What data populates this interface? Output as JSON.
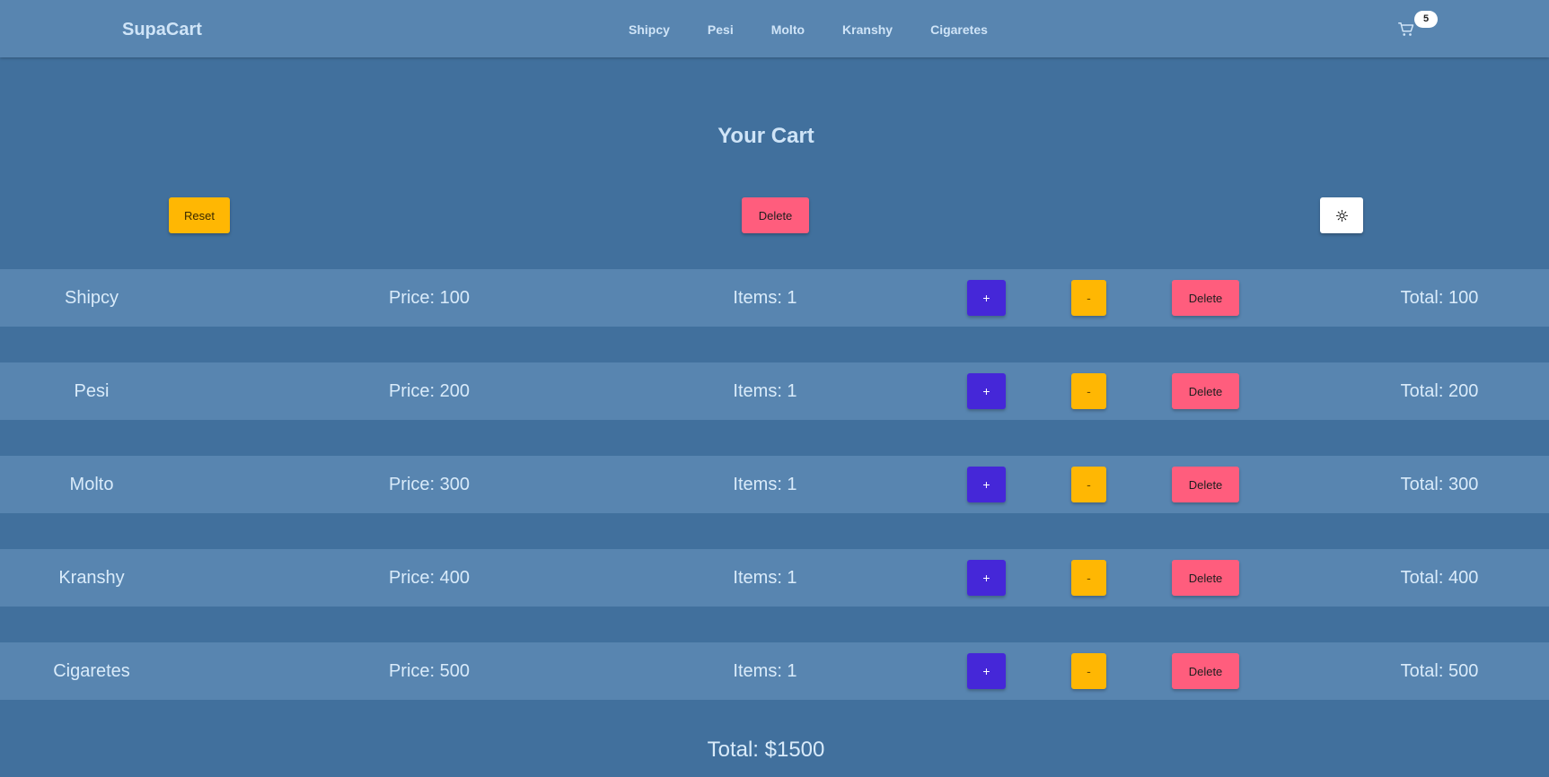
{
  "navbar": {
    "brand": "SupaCart",
    "links": [
      "Shipcy",
      "Pesi",
      "Molto",
      "Kranshy",
      "Cigaretes"
    ],
    "cart_icon": "cart-icon",
    "cart_count": "5"
  },
  "main": {
    "title": "Your Cart",
    "reset_label": "Reset",
    "delete_all_label": "Delete",
    "theme_icon": "sun-icon"
  },
  "items": [
    {
      "name": "Shipcy",
      "price": "Price: 100",
      "items": "Items: 1",
      "plus": "+",
      "minus": "-",
      "delete": "Delete",
      "total": "Total: 100"
    },
    {
      "name": "Pesi",
      "price": "Price: 200",
      "items": "Items: 1",
      "plus": "+",
      "minus": "-",
      "delete": "Delete",
      "total": "Total: 200"
    },
    {
      "name": "Molto",
      "price": "Price: 300",
      "items": "Items: 1",
      "plus": "+",
      "minus": "-",
      "delete": "Delete",
      "total": "Total: 300"
    },
    {
      "name": "Kranshy",
      "price": "Price: 400",
      "items": "Items: 1",
      "plus": "+",
      "minus": "-",
      "delete": "Delete",
      "total": "Total: 400"
    },
    {
      "name": "Cigaretes",
      "price": "Price: 500",
      "items": "Items: 1",
      "plus": "+",
      "minus": "-",
      "delete": "Delete",
      "total": "Total: 500"
    }
  ],
  "grand_total": "Total: $1500",
  "colors": {
    "page_background": "#41709d",
    "navbar_background": "#5885b0",
    "row_background": "#5885b0",
    "reset_button": "#ffb703",
    "delete_button": "#ff5d7d",
    "plus_button": "#4527d8",
    "minus_button": "#ffb703",
    "text_light": "#cfe4f7"
  }
}
